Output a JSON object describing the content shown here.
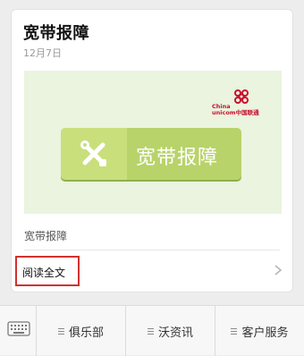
{
  "article": {
    "title": "宽带报障",
    "date": "12月7日",
    "banner": {
      "logo_text_line1": "China",
      "logo_text_line2": "unicom中国联通",
      "button_label": "宽带报障",
      "button_icon": "tools-icon"
    },
    "caption": "宽带报障",
    "read_more": "阅读全文"
  },
  "bottom_menu": {
    "items": [
      {
        "label": "俱乐部",
        "icon": "menu-lines-icon"
      },
      {
        "label": "沃资讯",
        "icon": "menu-lines-icon"
      },
      {
        "label": "客户服务",
        "icon": "menu-lines-icon"
      }
    ]
  },
  "colors": {
    "banner_bg": "#eaf4df",
    "button_green": "#b8d36a",
    "highlight_red": "#d0322e",
    "brand_red": "#c8102e"
  }
}
